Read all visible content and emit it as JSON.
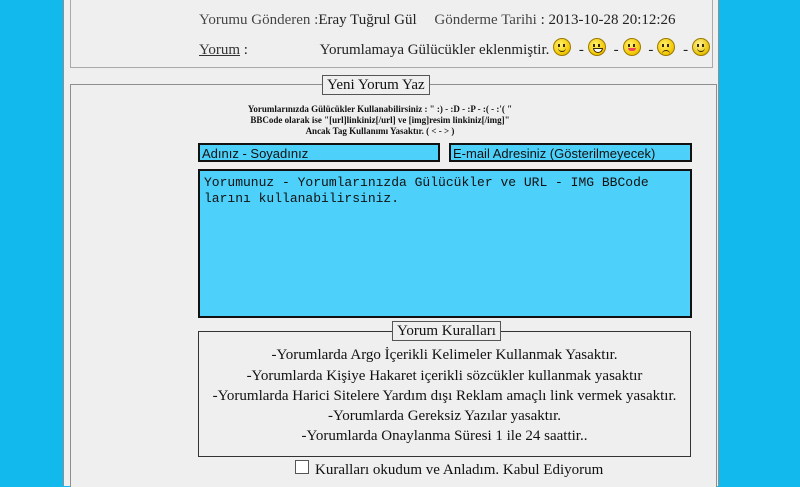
{
  "previous_comment": {
    "sender_label": "Yorumu Gönderen :",
    "sender_name": "Eray Tuğrul Gül",
    "date_label": "Gönderme Tarihi",
    "date_value": ": 2013-10-28 20:12:26",
    "comment_label": "Yorum",
    "comment_colon": ":",
    "comment_text": "Yorumlamaya Gülücükler eklenmiştir.",
    "smileys": [
      "smile-icon",
      "grin-icon",
      "tongue-icon",
      "sad-icon",
      "eye-smiley-icon"
    ],
    "separator": "-"
  },
  "new_comment": {
    "legend": "Yeni Yorum Yaz",
    "smiley_note": "Yorumlarınızda Gülücükler Kullanabilirsiniz : \" :) - :D - :P - :( - :'( \"",
    "bbcode_note": "BBCode olarak ise \"[url]linkiniz[/url] ve [img]resim linkiniz[/img]\"",
    "tag_note": "Ancak Tag Kullanımı Yasaktır. ( < - > )",
    "name_placeholder": "Adınız - Soyadınız",
    "email_placeholder": "E-mail Adresiniz (Gösterilmeyecek)",
    "comment_placeholder": "Yorumunuz - Yorumlarınızda Gülücükler ve URL - IMG BBCode larını kullanabilirsiniz."
  },
  "rules": {
    "legend": "Yorum Kuralları",
    "items": [
      "-Yorumlarda Argo İçerikli Kelimeler Kullanmak Yasaktır.",
      "-Yorumlarda Kişiye Hakaret içerikli sözcükler kullanmak yasaktır",
      "-Yorumlarda Harici Sitelere Yardım dışı Reklam amaçlı link vermek yasaktır.",
      "-Yorumlarda Gereksiz Yazılar yasaktır.",
      "-Yorumlarda Onaylanma Süresi 1 ile 24 saattir.."
    ],
    "accept_label": "Kuralları okudum ve Anladım. Kabul Ediyorum"
  },
  "colors": {
    "background": "#12b9ec",
    "field": "#4dd0f9",
    "panel": "#efefef"
  }
}
